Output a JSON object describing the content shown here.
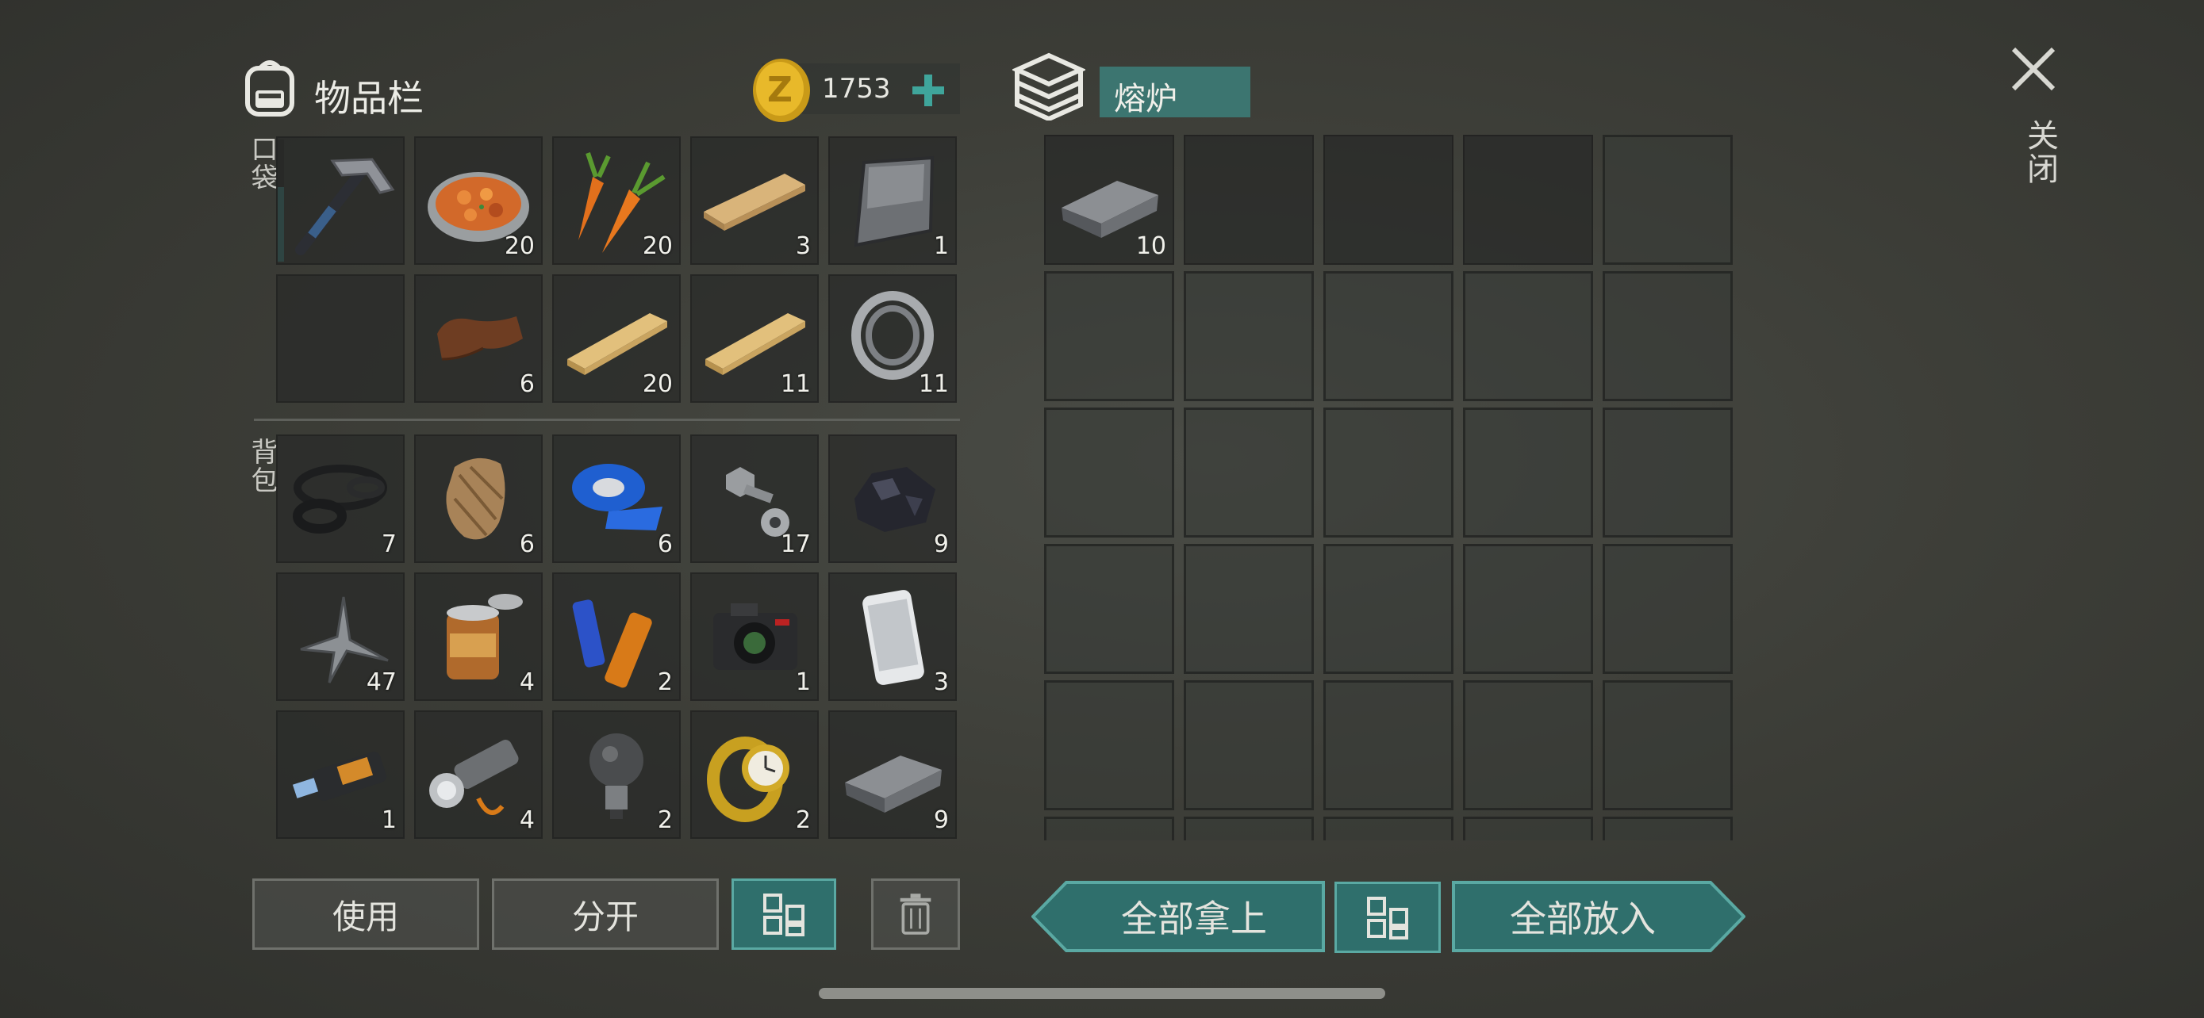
{
  "header": {
    "inventory_title": "物品栏",
    "coins": "1753",
    "container_title": "熔炉",
    "close_label": "关闭"
  },
  "sections": {
    "pocket_label": "口袋",
    "backpack_label": "背包"
  },
  "pocket": [
    {
      "item": "pickaxe",
      "count": ""
    },
    {
      "item": "cooked-food",
      "count": "20"
    },
    {
      "item": "carrot",
      "count": "20"
    },
    {
      "item": "wood-board",
      "count": "3"
    },
    {
      "item": "metal-plate",
      "count": "1"
    },
    {
      "item": "empty",
      "count": ""
    },
    {
      "item": "leather",
      "count": "6"
    },
    {
      "item": "wood-plank",
      "count": "20"
    },
    {
      "item": "wood-plank",
      "count": "11"
    },
    {
      "item": "bearing",
      "count": "11"
    }
  ],
  "backpack": [
    {
      "item": "rubber-rings",
      "count": "7"
    },
    {
      "item": "fur",
      "count": "6"
    },
    {
      "item": "blue-tape",
      "count": "6"
    },
    {
      "item": "bolts-nuts",
      "count": "17"
    },
    {
      "item": "coal-ore",
      "count": "9"
    },
    {
      "item": "scrap-metal",
      "count": "47"
    },
    {
      "item": "tin-can",
      "count": "4"
    },
    {
      "item": "batteries",
      "count": "2"
    },
    {
      "item": "camera",
      "count": "1"
    },
    {
      "item": "smartphone",
      "count": "3"
    },
    {
      "item": "usb-drive",
      "count": "1"
    },
    {
      "item": "flashlight",
      "count": "4"
    },
    {
      "item": "light-bulb",
      "count": "2"
    },
    {
      "item": "wristwatch",
      "count": "2"
    },
    {
      "item": "iron-ingot",
      "count": "9"
    }
  ],
  "furnace": [
    {
      "item": "iron-ingot",
      "count": "10"
    }
  ],
  "buttons": {
    "use": "使用",
    "split": "分开",
    "take_all": "全部拿上",
    "put_all": "全部放入"
  },
  "colors": {
    "accent_teal": "#2f6f6c",
    "teal_border": "#5aa9a3"
  }
}
